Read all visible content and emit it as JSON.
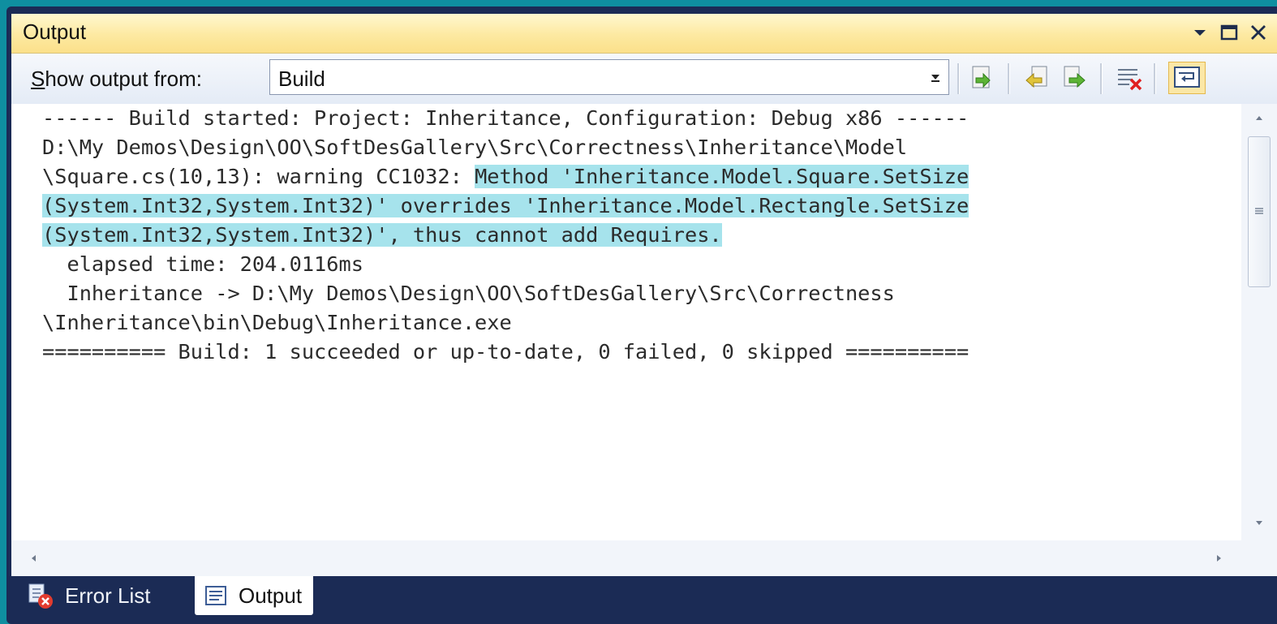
{
  "window": {
    "title": "Output"
  },
  "toolbar": {
    "show_output_label_prefix": "S",
    "show_output_label_rest": "how output from:",
    "source_selected": "Build",
    "buttons": [
      "go-to-next-message-icon",
      "find-previous-icon",
      "find-next-icon",
      "clear-all-icon",
      "toggle-word-wrap-icon"
    ]
  },
  "output": {
    "line1": "------ Build started: Project: Inheritance, Configuration: Debug x86 ------",
    "line2": "D:\\My Demos\\Design\\OO\\SoftDesGallery\\Src\\Correctness\\Inheritance\\Model",
    "line3_plain": "\\Square.cs(10,13): warning CC1032: ",
    "line3_hl": "Method 'Inheritance.Model.Square.SetSize",
    "line4_hl": "(System.Int32,System.Int32)' overrides 'Inheritance.Model.Rectangle.SetSize",
    "line5_hl": "(System.Int32,System.Int32)', thus cannot add Requires.",
    "line6": "  elapsed time: 204.0116ms",
    "line7": "  Inheritance -> D:\\My Demos\\Design\\OO\\SoftDesGallery\\Src\\Correctness",
    "line8": "\\Inheritance\\bin\\Debug\\Inheritance.exe",
    "line9": "========== Build: 1 succeeded or up-to-date, 0 failed, 0 skipped =========="
  },
  "tabs": [
    {
      "label": "Error List",
      "icon": "error-list-icon"
    },
    {
      "label": "Output",
      "icon": "output-icon"
    }
  ],
  "colors": {
    "highlight": "#a6e3ec",
    "title_bar": "#fde9a1",
    "tab_strip": "#1b2b55"
  }
}
